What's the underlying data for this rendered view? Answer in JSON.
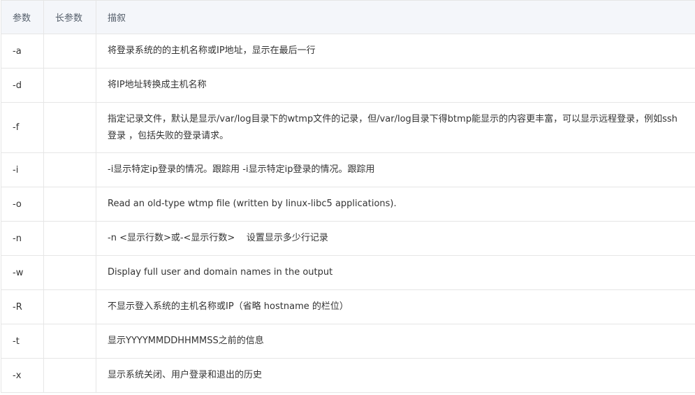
{
  "table": {
    "headers": [
      "参数",
      "长参数",
      "描叙"
    ],
    "rows": [
      {
        "param": "-a",
        "long": "",
        "desc": "将登录系统的的主机名称或IP地址，显示在最后一行"
      },
      {
        "param": "-d",
        "long": "",
        "desc": "将IP地址转换成主机名称"
      },
      {
        "param": "-f",
        "long": "",
        "desc": "指定记录文件，默认是显示/var/log目录下的wtmp文件的记录，但/var/log目录下得btmp能显示的内容更丰富，可以显示远程登录，例如ssh登录 ，包括失败的登录请求。"
      },
      {
        "param": "-i",
        "long": "",
        "desc": "-i显示特定ip登录的情况。跟踪用 -i显示特定ip登录的情况。跟踪用"
      },
      {
        "param": "-o",
        "long": "",
        "desc": "Read an old-type wtmp file (written by linux-libc5 applications)."
      },
      {
        "param": "-n",
        "long": "",
        "desc": "-n <显示行数>或-<显示行数>    设置显示多少行记录"
      },
      {
        "param": "-w",
        "long": "",
        "desc": "Display full user and domain names in the output"
      },
      {
        "param": "-R",
        "long": "",
        "desc": "不显示登入系统的主机名称或IP（省略 hostname 的栏位）"
      },
      {
        "param": "-t",
        "long": "",
        "desc": "显示YYYYMMDDHHMMSS之前的信息"
      },
      {
        "param": "-x",
        "long": "",
        "desc": "显示系统关闭、用户登录和退出的历史"
      }
    ]
  }
}
